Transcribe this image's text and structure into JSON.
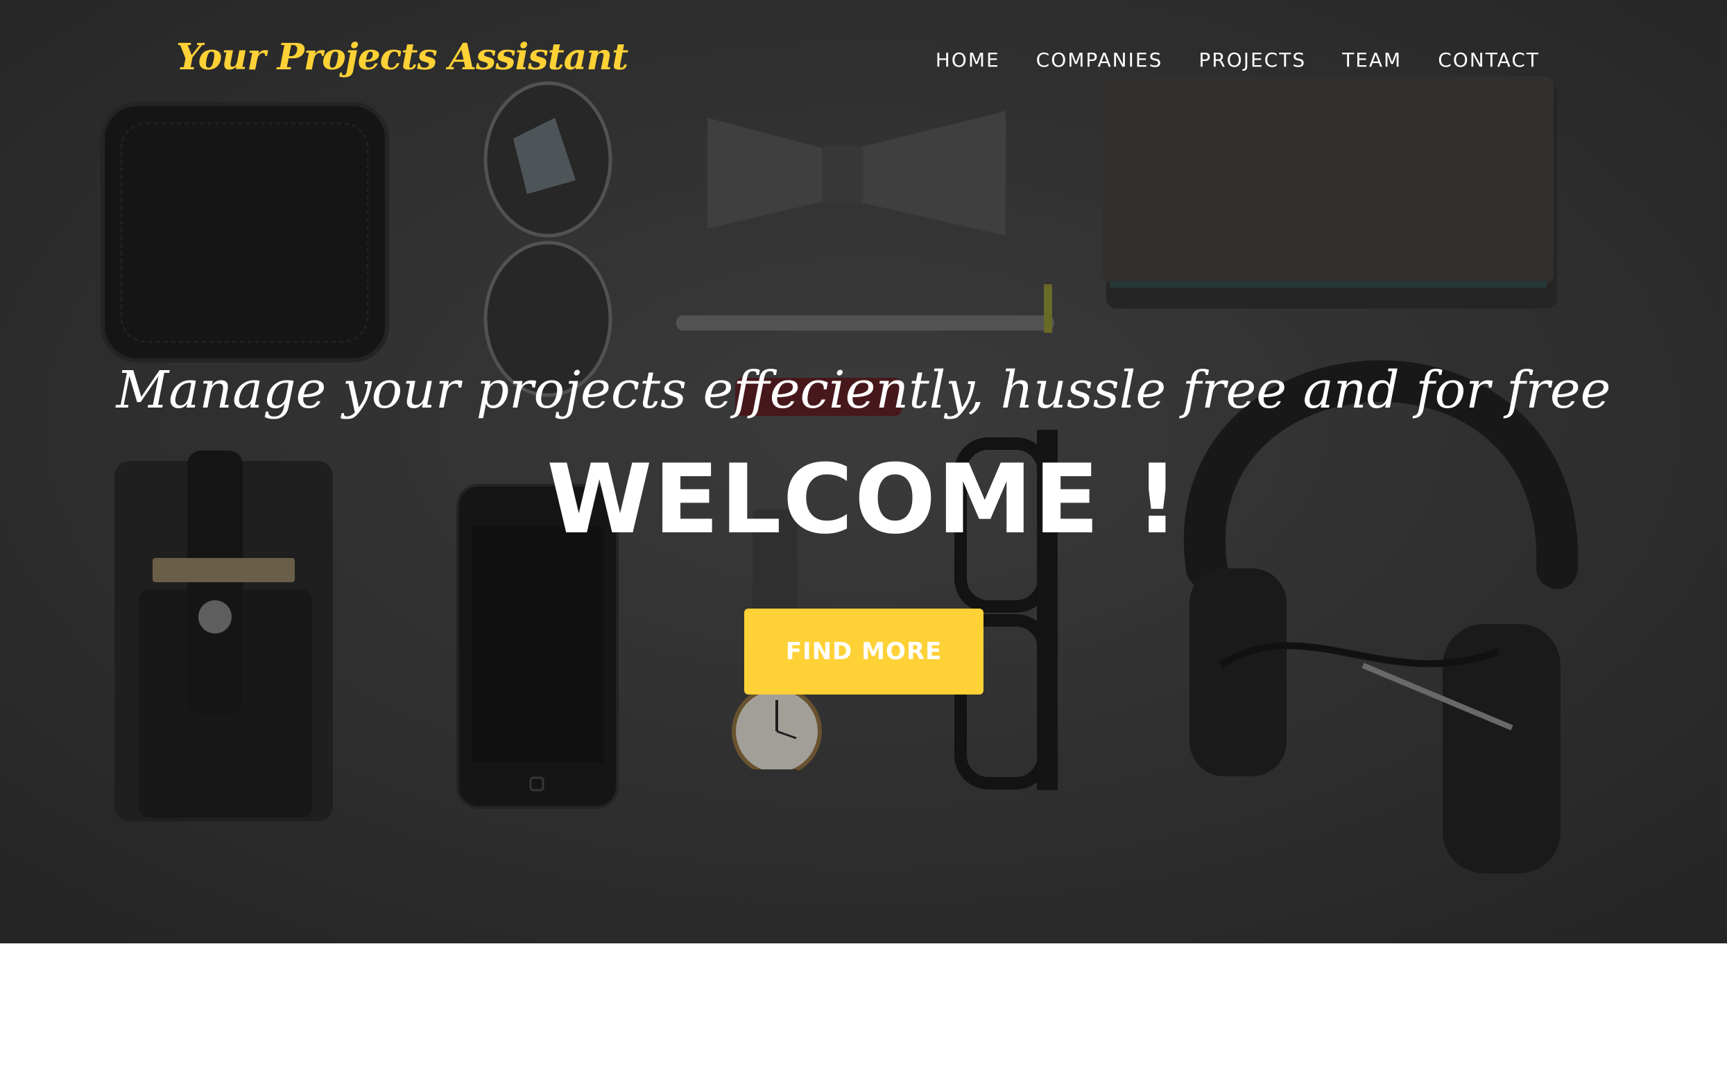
{
  "navbar": {
    "brand": "Your Projects Assistant",
    "links": [
      "HOME",
      "COMPANIES",
      "PROJECTS",
      "TEAM",
      "CONTACT"
    ]
  },
  "hero": {
    "lead": "Manage your projects effeciently, hussle free and for free",
    "heading": "WELCOME !",
    "button": "FIND MORE"
  },
  "colors": {
    "accent": "#fed136",
    "hero_background": "#3a3a3a",
    "text": "#ffffff"
  }
}
